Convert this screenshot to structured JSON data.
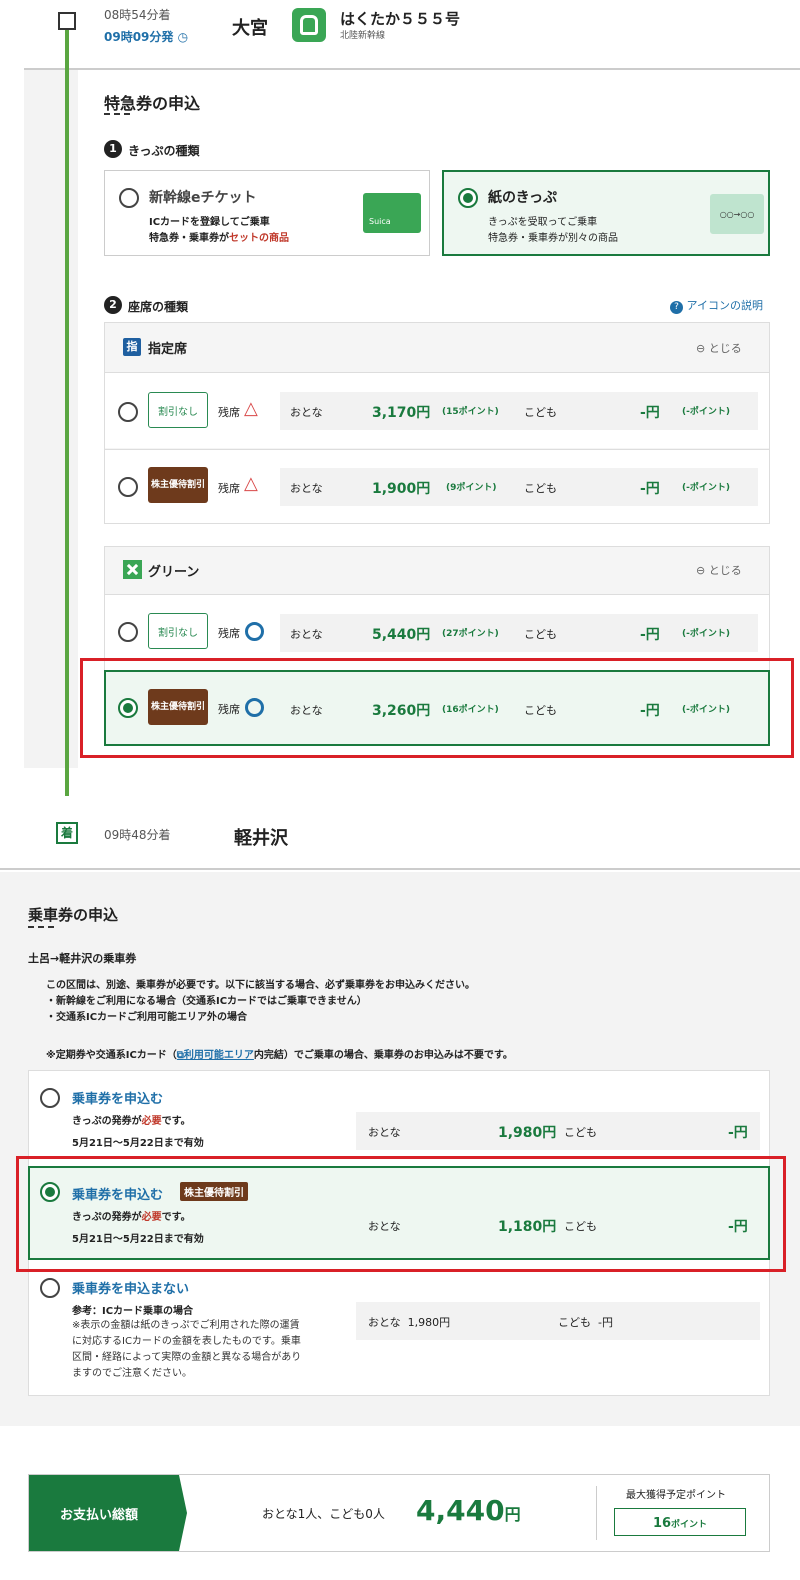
{
  "top": {
    "arrive_time": "08時54分着",
    "depart_time": "09時09分発",
    "station": "大宮",
    "train_name": "はくたか５５５号",
    "line_name": "北陸新幹線"
  },
  "express": {
    "title": "特急券の申込",
    "step1_label": "きっぷの種類",
    "step1_number": "1",
    "ticket_types": [
      {
        "name": "新幹線eチケット",
        "desc1": "ICカードを登録してご乗車",
        "desc2a": "特急券・乗車券が",
        "desc2b": "セットの商品",
        "icon_text": "Suica"
      },
      {
        "name": "紙のきっぷ",
        "desc1": "きっぷを受取ってご乗車",
        "desc2": "特急券・乗車券が別々の商品",
        "icon_text": "○○→○○"
      }
    ],
    "step2_label": "座席の種類",
    "step2_number": "2",
    "icon_help": "アイコンの説明",
    "reserved": {
      "badge": "指",
      "title": "指定席",
      "close": "とじる",
      "rows": [
        {
          "tag": "割引なし",
          "seat": "残席",
          "adult_label": "おとな",
          "adult_price": "3,170円",
          "adult_points": "(15ポイント)",
          "child_label": "こども",
          "child_price": "-円",
          "child_points": "(-ポイント)"
        },
        {
          "tag": "株主優待割引",
          "seat": "残席",
          "adult_label": "おとな",
          "adult_price": "1,900円",
          "adult_points": "(9ポイント)",
          "child_label": "こども",
          "child_price": "-円",
          "child_points": "(-ポイント)"
        }
      ]
    },
    "green": {
      "title": "グリーン",
      "close": "とじる",
      "rows": [
        {
          "tag": "割引なし",
          "seat": "残席",
          "adult_label": "おとな",
          "adult_price": "5,440円",
          "adult_points": "(27ポイント)",
          "child_label": "こども",
          "child_price": "-円",
          "child_points": "(-ポイント)"
        },
        {
          "tag": "株主優待割引",
          "seat": "残席",
          "adult_label": "おとな",
          "adult_price": "3,260円",
          "adult_points": "(16ポイント)",
          "child_label": "こども",
          "child_price": "-円",
          "child_points": "(-ポイント)"
        }
      ]
    }
  },
  "arrival": {
    "badge": "着",
    "time": "09時48分着",
    "station": "軽井沢"
  },
  "fare": {
    "title": "乗車券の申込",
    "route": "土呂→軽井沢の乗車券",
    "note1": "この区間は、別途、乗車券が必要です。以下に該当する場合、必ず乗車券をお申込みください。",
    "note2": "・新幹線をご利用になる場合（交通系ICカードではご乗車できません）",
    "note3": "・交通系ICカードご利用可能エリア外の場合",
    "note4a": "※定期券や交通系ICカード（",
    "note4link": "利用可能エリア",
    "note4b": "内完結）でご乗車の場合、乗車券のお申込みは不要です。",
    "options": [
      {
        "title": "乗車券を申込む",
        "line1a": "きっぷの発券が",
        "line1b": "必要",
        "line1c": "です。",
        "line2": "5月21日～5月22日まで有効",
        "adult_label": "おとな",
        "adult_price": "1,980円",
        "child_label": "こども",
        "child_price": "-円"
      },
      {
        "title": "乗車券を申込む",
        "tag": "株主優待割引",
        "line1a": "きっぷの発券が",
        "line1b": "必要",
        "line1c": "です。",
        "line2": "5月21日～5月22日まで有効",
        "adult_label": "おとな",
        "adult_price": "1,180円",
        "child_label": "こども",
        "child_price": "-円"
      },
      {
        "title": "乗車券を申込まない",
        "ref": "参考：ICカード乗車の場合",
        "n1": "※表示の金額は紙のきっぷでご利用された際の運賃",
        "n2": "に対応するICカードの金額を表したものです。乗車",
        "n3": "区間・経路によって実際の金額と異なる場合があり",
        "n4": "ますのでご注意ください。",
        "adult": "おとな  1,980円",
        "child": "こども  -円"
      }
    ]
  },
  "total": {
    "label": "お支払い総額",
    "people": "おとな1人、こども0人",
    "amount": "4,440",
    "unit": "円",
    "points_label": "最大獲得予定ポイント",
    "points": "16",
    "points_unit": "ポイント"
  }
}
